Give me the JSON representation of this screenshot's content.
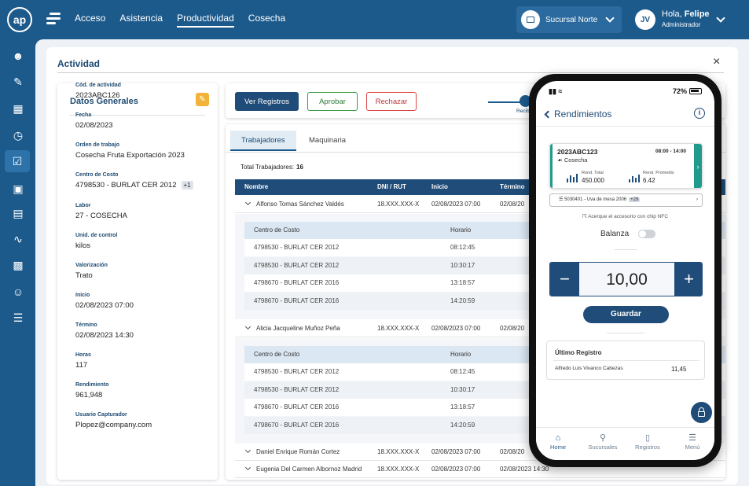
{
  "app": {
    "logo_text": "ap"
  },
  "nav": {
    "items": [
      "Acceso",
      "Asistencia",
      "Productividad",
      "Cosecha"
    ],
    "active_index": 2
  },
  "branch": {
    "label": "Sucursal Norte",
    "icon": "building-icon"
  },
  "user": {
    "initials": "JV",
    "greeting": "Hola,",
    "name": "Felipe",
    "role": "Administrador"
  },
  "sidebar": {
    "icons": [
      "user-icon",
      "edit-doc-icon",
      "buildings-icon",
      "clock-icon",
      "calendar-check-icon",
      "briefcase-clock-icon",
      "calendar-icon",
      "route-icon",
      "doc-money-icon",
      "user-list-icon",
      "list-icon"
    ],
    "active_index": 4
  },
  "activity": {
    "title": "Actividad",
    "close": "×"
  },
  "datos": {
    "title": "Datos Generales",
    "fields": [
      {
        "label": "Cód. de actividad",
        "value": "2023ABC126"
      },
      {
        "label": "Fecha",
        "value": "02/08/2023"
      },
      {
        "label": "Orden de trabajo",
        "value": "Cosecha Fruta Exportación 2023"
      },
      {
        "label": "Centro de Costo",
        "value": "4798530 - BURLAT CER 2012",
        "badge": "+1"
      },
      {
        "label": "Labor",
        "value": "27 - COSECHA"
      },
      {
        "label": "Unid. de control",
        "value": "kilos"
      },
      {
        "label": "Valorización",
        "value": "Trato"
      },
      {
        "label": "Inicio",
        "value": "02/08/2023 07:00"
      },
      {
        "label": "Término",
        "value": "02/08/2023 14:30"
      },
      {
        "label": "Horas",
        "value": "117"
      },
      {
        "label": "Rendimiento",
        "value": "961,948"
      },
      {
        "label": "Usuario Capturador",
        "value": "Plopez@company.com"
      }
    ]
  },
  "actions": {
    "ver": "Ver Registros",
    "aprobar": "Aprobar",
    "rechazar": "Rechazar",
    "step_label": "Recib"
  },
  "table": {
    "tabs": [
      "Trabajadores",
      "Maquinaria"
    ],
    "total_label": "Total Trabajadores:",
    "total_value": "16",
    "columns": [
      "Nombre",
      "DNI / RUT",
      "Inicio",
      "Término"
    ],
    "sub_columns": [
      "Centro de Costo",
      "Horario"
    ],
    "workers": [
      {
        "name": "Alfonso Tomas Sánchez Valdés",
        "dni": "18.XXX.XXX-X",
        "inicio": "02/08/2023 07:00",
        "termino": "02/08/20"
      },
      {
        "name": "Alicia Jacqueline Muñoz Peña",
        "dni": "18.XXX.XXX-X",
        "inicio": "02/08/2023 07:00",
        "termino": "02/08/20"
      },
      {
        "name": "Daniel Enrique Román Cortez",
        "dni": "18.XXX.XXX-X",
        "inicio": "02/08/2023 07:00",
        "termino": "02/08/20"
      },
      {
        "name": "Eugenia Del Carmen Albornoz Madrid",
        "dni": "18.XXX.XXX-X",
        "inicio": "02/08/2023 07:00",
        "termino": "02/08/2023 14:30"
      }
    ],
    "sub_rows": [
      {
        "cc": "4798530 - BURLAT CER 2012",
        "horario": "08:12:45"
      },
      {
        "cc": "4798530 - BURLAT CER 2012",
        "horario": "10:30:17"
      },
      {
        "cc": "4798670 - BURLAT CER 2016",
        "horario": "13:18:57"
      },
      {
        "cc": "4798670 - BURLAT CER 2016",
        "horario": "14:20:59"
      }
    ]
  },
  "phone": {
    "battery": "72%",
    "title": "Rendimientos",
    "card": {
      "code": "2023ABC123",
      "time": "08:00 - 14:00",
      "task": "Cosecha",
      "rend_total_label": "Rend. Total",
      "rend_total": "450.000",
      "rend_prom_label": "Rend. Promedio",
      "rend_prom": "6.42"
    },
    "cost_center": {
      "text": "5030401 - Uva de mesa 2006",
      "extra": "+29"
    },
    "nfc": "Acerque el accesorio con chip NFC",
    "balanza": "Balanza",
    "stepper": {
      "minus": "−",
      "value": "10,00",
      "plus": "+"
    },
    "save": "Guardar",
    "last": {
      "title": "Último Registro",
      "name": "Alfredo Luis Vivanco Cabezas",
      "value": "11,45"
    },
    "nav": [
      "Home",
      "Sucursales",
      "Registros",
      "Menú"
    ]
  }
}
